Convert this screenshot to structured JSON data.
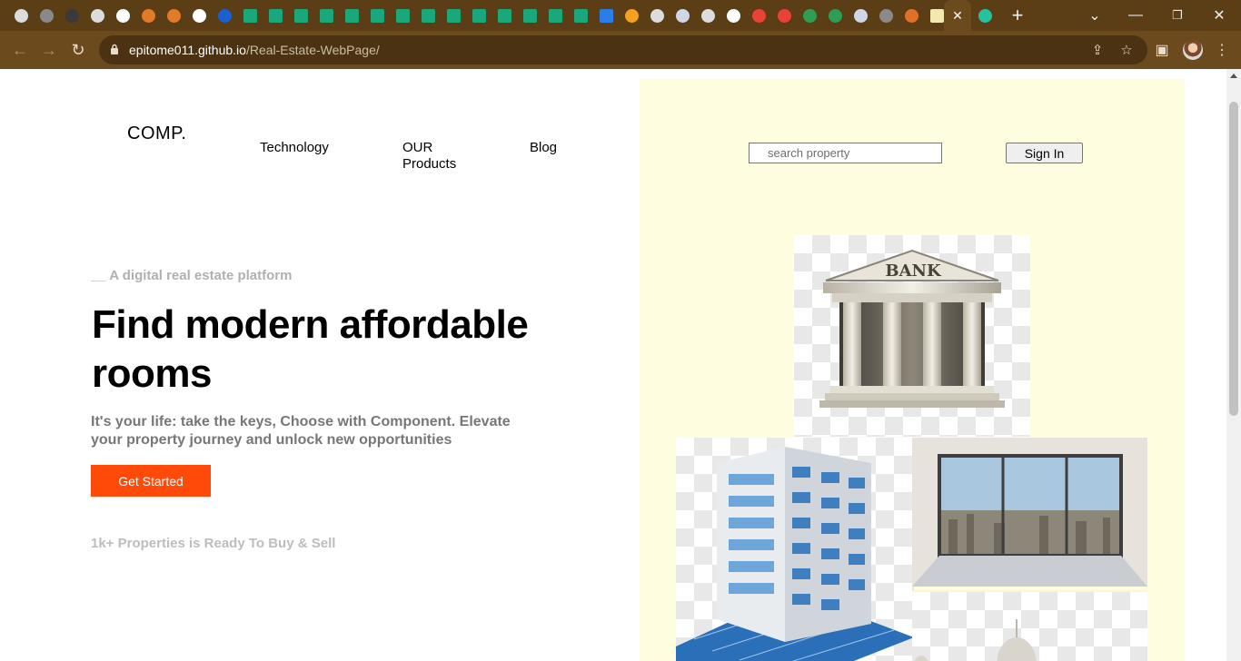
{
  "browser": {
    "url_domain": "epitome011.github.io",
    "url_path": "/Real-Estate-WebPage/",
    "tab_icons": [
      "chrome-icon",
      "globe-icon",
      "olx-icon",
      "chrome-icon",
      "google-icon",
      "diamond-icon",
      "diamond-icon",
      "reddit-icon",
      "circle-icon",
      "w-icon",
      "w-icon",
      "w-icon",
      "w-icon",
      "w-icon",
      "w-icon",
      "w-icon",
      "w-icon",
      "w-icon",
      "w-icon",
      "w-icon",
      "w-icon",
      "w-icon",
      "w-icon",
      "doc-icon",
      "slides-icon",
      "chrome-icon",
      "flag-icon",
      "chrome-icon",
      "google-icon",
      "gmail-icon",
      "gmail-icon",
      "drive-icon",
      "drive-icon",
      "flag-icon",
      "globe-icon",
      "matlab-icon",
      "note-icon",
      "github-icon",
      "close-icon",
      "asterisk-icon"
    ],
    "new_tab_label": "+",
    "close_tab_label": "✕"
  },
  "site": {
    "logo": "COMP.",
    "nav": {
      "technology": "Technology",
      "products_line1": "OUR",
      "products_line2": "Products",
      "blog": "Blog"
    },
    "search_placeholder": "search property",
    "signin_label": "Sign In"
  },
  "hero": {
    "tagline": "__ A digital real estate platform",
    "headline": "Find modern affordable rooms",
    "subtext": "It's your life: take the keys, Choose with Component. Elevate your property journey and unlock new opportunities",
    "cta_label": "Get Started",
    "stats": "1k+ Properties is Ready To Buy & Sell"
  },
  "images": {
    "bank_label": "BANK"
  },
  "colors": {
    "accent": "#ff4a0a",
    "panel": "#fffde0",
    "chrome": "#5b3d16"
  }
}
